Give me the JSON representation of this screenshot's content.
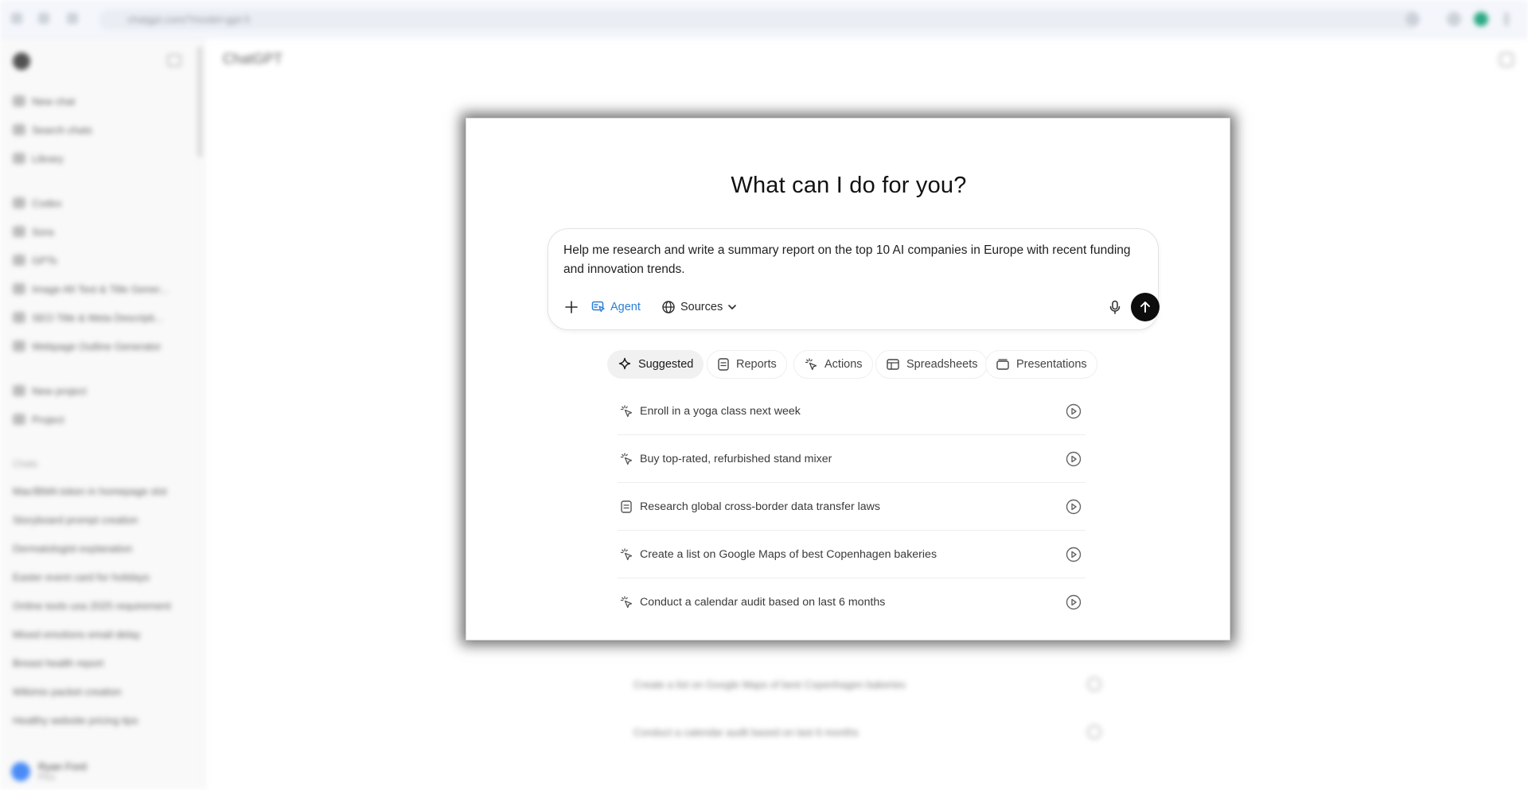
{
  "background": {
    "browser": {
      "address_text": "chatgpt.com/?model=gpt-5"
    },
    "sidebar": {
      "items": [
        {
          "label": "New chat"
        },
        {
          "label": "Search chats"
        },
        {
          "label": "Library"
        },
        {
          "label": "Codex"
        },
        {
          "label": "Sora"
        },
        {
          "label": "GPTs"
        },
        {
          "label": "Image Alt Text & Title Gener..."
        },
        {
          "label": "SEO Title & Meta Descripti..."
        },
        {
          "label": "Webpage Outline Generator"
        },
        {
          "label": "New project"
        },
        {
          "label": "Project"
        }
      ],
      "chats_section": "Chats",
      "chats": [
        {
          "label": "Mac/BMA token in homepage slot"
        },
        {
          "label": "Storyboard prompt creation"
        },
        {
          "label": "Dermatologist explanation"
        },
        {
          "label": "Easter event card for holidays"
        },
        {
          "label": "Online tools usa 2025 requirement"
        },
        {
          "label": "Mixed emotions email delay"
        },
        {
          "label": "Breast health report"
        },
        {
          "label": "Wikimix packet creation"
        },
        {
          "label": "Healthy website pricing tips"
        }
      ],
      "user_name": "Ryan Ford",
      "user_plan": "Plus"
    },
    "main_title": "ChatGPT",
    "ghost_rows": [
      {
        "label": "Create a list on Google Maps of best Copenhagen bakeries"
      },
      {
        "label": "Conduct a calendar audit based on last 6 months"
      }
    ]
  },
  "card": {
    "headline": "What can I do for you?",
    "composer": {
      "prompt": "Help me research and write a summary report on the top 10 AI companies in Europe with recent funding and innovation trends.",
      "agent_label": "Agent",
      "sources_label": "Sources"
    },
    "tabs": [
      {
        "label": "Suggested",
        "icon": "sparkle-icon",
        "active": true
      },
      {
        "label": "Reports",
        "icon": "document-icon",
        "active": false
      },
      {
        "label": "Actions",
        "icon": "cursor-click-icon",
        "active": false
      },
      {
        "label": "Spreadsheets",
        "icon": "table-icon",
        "active": false
      },
      {
        "label": "Presentations",
        "icon": "slides-icon",
        "active": false
      }
    ],
    "suggestions": [
      {
        "label": "Enroll in a yoga class next week",
        "icon": "cursor-click-icon"
      },
      {
        "label": "Buy top-rated, refurbished stand mixer",
        "icon": "cursor-click-icon"
      },
      {
        "label": "Research global cross-border data transfer laws",
        "icon": "document-icon"
      },
      {
        "label": "Create a list on Google Maps of best Copenhagen bakeries",
        "icon": "cursor-click-icon"
      },
      {
        "label": "Conduct a calendar audit based on last 6 months",
        "icon": "cursor-click-icon"
      }
    ]
  },
  "colors": {
    "agent_accent": "#2b7fd6",
    "send_button": "#0d0d0d",
    "active_tab_bg": "#f1f1f1"
  }
}
